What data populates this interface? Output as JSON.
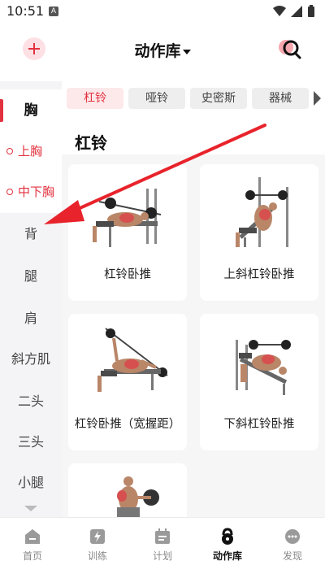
{
  "status": {
    "time": "10:51",
    "notification_icon": "A"
  },
  "header": {
    "title": "动作库",
    "add_icon": "plus-icon",
    "search_icon": "search-icon"
  },
  "sidebar": {
    "items": [
      {
        "label": "胸",
        "state": "active"
      },
      {
        "label": "上胸",
        "state": "sub"
      },
      {
        "label": "中下胸",
        "state": "sub"
      },
      {
        "label": "背",
        "state": "normal"
      },
      {
        "label": "腿",
        "state": "normal"
      },
      {
        "label": "肩",
        "state": "normal"
      },
      {
        "label": "斜方肌",
        "state": "normal"
      },
      {
        "label": "二头",
        "state": "normal"
      },
      {
        "label": "三头",
        "state": "normal"
      },
      {
        "label": "小腿",
        "state": "normal"
      }
    ]
  },
  "tabs": [
    {
      "label": "杠铃",
      "active": true
    },
    {
      "label": "哑铃",
      "active": false
    },
    {
      "label": "史密斯",
      "active": false
    },
    {
      "label": "器械",
      "active": false
    }
  ],
  "section": {
    "title": "杠铃"
  },
  "exercises": [
    {
      "label": "杠铃卧推"
    },
    {
      "label": "上斜杠铃卧推"
    },
    {
      "label": "杠铃卧推（宽握距）"
    },
    {
      "label": "下斜杠铃卧推"
    },
    {
      "label": ""
    }
  ],
  "bottom_nav": [
    {
      "label": "首页",
      "icon": "home-icon"
    },
    {
      "label": "训练",
      "icon": "lightning-icon"
    },
    {
      "label": "计划",
      "icon": "calendar-icon"
    },
    {
      "label": "动作库",
      "icon": "kettlebell-icon",
      "active": true
    },
    {
      "label": "发现",
      "icon": "chat-icon"
    }
  ],
  "colors": {
    "accent": "#e2323f",
    "sidebar_bg": "#f4f4f6",
    "tab_bg": "#eeeeef"
  }
}
